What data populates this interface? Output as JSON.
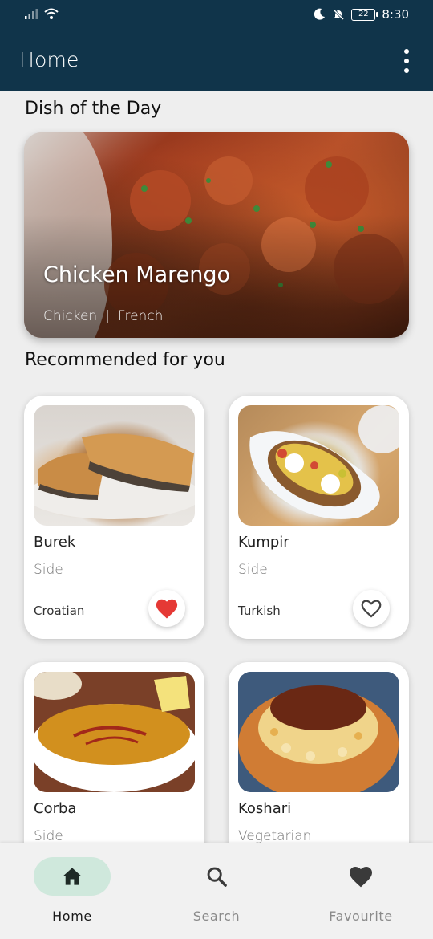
{
  "status_bar": {
    "time": "8:30",
    "battery": "22",
    "icons": [
      "signal-icon",
      "wifi-icon",
      "moon-icon",
      "mute-icon",
      "battery-icon"
    ]
  },
  "app_bar": {
    "title": "Home",
    "menu_icon": "more-vert-icon"
  },
  "dish_of_day": {
    "section_title": "Dish of the Day",
    "name": "Chicken Marengo",
    "category": "Chicken",
    "separator": "|",
    "area": "French"
  },
  "recommended": {
    "section_title": "Recommended for you",
    "items": [
      {
        "name": "Burek",
        "category": "Side",
        "area": "Croatian",
        "favourite": true
      },
      {
        "name": "Kumpir",
        "category": "Side",
        "area": "Turkish",
        "favourite": false
      },
      {
        "name": "Corba",
        "category": "Side",
        "area": "",
        "favourite": false
      },
      {
        "name": "Koshari",
        "category": "Vegetarian",
        "area": "",
        "favourite": false
      }
    ]
  },
  "bottom_nav": {
    "items": [
      {
        "label": "Home",
        "icon": "home-icon",
        "active": true
      },
      {
        "label": "Search",
        "icon": "search-icon",
        "active": false
      },
      {
        "label": "Favourite",
        "icon": "heart-icon",
        "active": false
      }
    ]
  },
  "colors": {
    "app_bar": "#10344a",
    "heart_active": "#e53935",
    "nav_active_pill": "#cfe8dc"
  }
}
